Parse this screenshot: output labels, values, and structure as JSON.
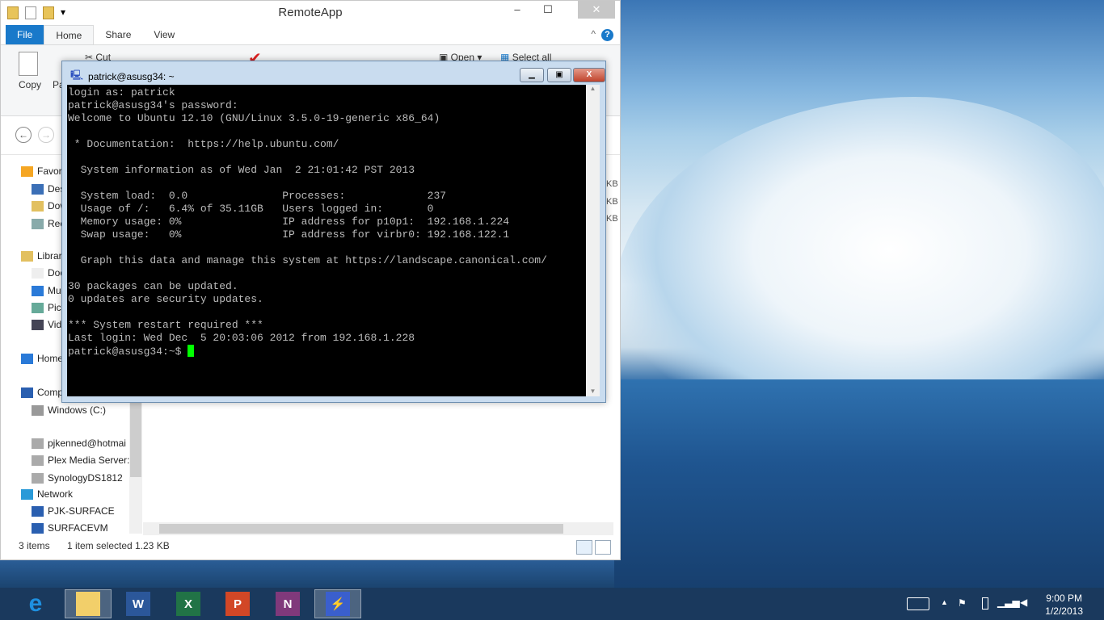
{
  "explorer": {
    "title": "RemoteApp",
    "tabs": [
      "File",
      "Home",
      "Share",
      "View"
    ],
    "ribbon": {
      "copy": "Copy",
      "paste": "Pa",
      "cut": "Cut",
      "open": "Open",
      "select_all": "Select all"
    },
    "nav": [
      {
        "label": "Favorites",
        "icon": "star-icon"
      },
      {
        "label": "Desktop",
        "icon": "desktop-icon"
      },
      {
        "label": "Downloads",
        "icon": "downloads-icon"
      },
      {
        "label": "Recent places",
        "icon": "recent-icon"
      },
      {
        "label": "Libraries",
        "icon": "library-icon"
      },
      {
        "label": "Documents",
        "icon": "document-icon"
      },
      {
        "label": "Music",
        "icon": "music-icon"
      },
      {
        "label": "Pictures",
        "icon": "pictures-icon"
      },
      {
        "label": "Videos",
        "icon": "videos-icon"
      },
      {
        "label": "Homegroup",
        "icon": "homegroup-icon"
      },
      {
        "label": "Computer",
        "icon": "computer-icon"
      },
      {
        "label": "Windows (C:)",
        "icon": "drive-icon"
      },
      {
        "label": "pjkenned@hotmai",
        "icon": "network-drive-icon"
      },
      {
        "label": "Plex Media Server: ",
        "icon": "network-drive-icon"
      },
      {
        "label": "SynologyDS1812",
        "icon": "network-drive-icon"
      },
      {
        "label": "Network",
        "icon": "network-icon"
      },
      {
        "label": "PJK-SURFACE",
        "icon": "computer-icon"
      },
      {
        "label": "SURFACEVM",
        "icon": "computer-icon"
      }
    ],
    "file_sizes": [
      "KB",
      "KB",
      "KB"
    ],
    "status": {
      "items": "3 items",
      "selected": "1 item selected",
      "size": "1.23 KB"
    }
  },
  "putty": {
    "title": "patrick@asusg34: ~",
    "lines": [
      "login as: patrick",
      "patrick@asusg34's password:",
      "Welcome to Ubuntu 12.10 (GNU/Linux 3.5.0-19-generic x86_64)",
      "",
      " * Documentation:  https://help.ubuntu.com/",
      "",
      "  System information as of Wed Jan  2 21:01:42 PST 2013",
      "",
      "  System load:  0.0               Processes:             237",
      "  Usage of /:   6.4% of 35.11GB   Users logged in:       0",
      "  Memory usage: 0%                IP address for p10p1:  192.168.1.224",
      "  Swap usage:   0%                IP address for virbr0: 192.168.122.1",
      "",
      "  Graph this data and manage this system at https://landscape.canonical.com/",
      "",
      "30 packages can be updated.",
      "0 updates are security updates.",
      "",
      "*** System restart required ***",
      "Last login: Wed Dec  5 20:03:06 2012 from 192.168.1.228"
    ],
    "prompt": "patrick@asusg34:~$ "
  },
  "taskbar": {
    "apps": [
      {
        "name": "internet-explorer",
        "glyph": "e",
        "color": "#1e90e0"
      },
      {
        "name": "file-explorer",
        "glyph": "",
        "color": "#f2cf6a"
      },
      {
        "name": "word",
        "glyph": "W",
        "color": "#2b579a"
      },
      {
        "name": "excel",
        "glyph": "X",
        "color": "#217346"
      },
      {
        "name": "powerpoint",
        "glyph": "P",
        "color": "#d24726"
      },
      {
        "name": "onenote",
        "glyph": "N",
        "color": "#80397b"
      },
      {
        "name": "putty",
        "glyph": "⚡",
        "color": "#3a5fcd"
      }
    ],
    "time": "9:00 PM",
    "date": "1/2/2013"
  }
}
